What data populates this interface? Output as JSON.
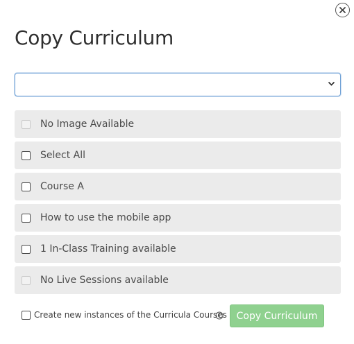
{
  "dialog": {
    "title": "Copy Curriculum",
    "select": {
      "value": ""
    },
    "items": [
      {
        "label": "No Image Available",
        "disabled": true
      },
      {
        "label": "Select All",
        "disabled": false
      },
      {
        "label": "Course A",
        "disabled": false
      },
      {
        "label": "How to use the mobile app",
        "disabled": false
      },
      {
        "label": "1 In-Class Training available",
        "disabled": false
      },
      {
        "label": "No Live Sessions available",
        "disabled": true
      }
    ],
    "footer": {
      "checkbox_label": "Create new instances of the Curricula Courses",
      "copy_button_label": "Copy Curriculum"
    }
  },
  "icons": {
    "close": "close-icon",
    "dropdown": "chevron-down-icon",
    "info": "info-icon"
  },
  "colors": {
    "primary_button": "#8fd18f",
    "row_background": "#ebebeb",
    "focus_border": "#6fa1d6"
  }
}
